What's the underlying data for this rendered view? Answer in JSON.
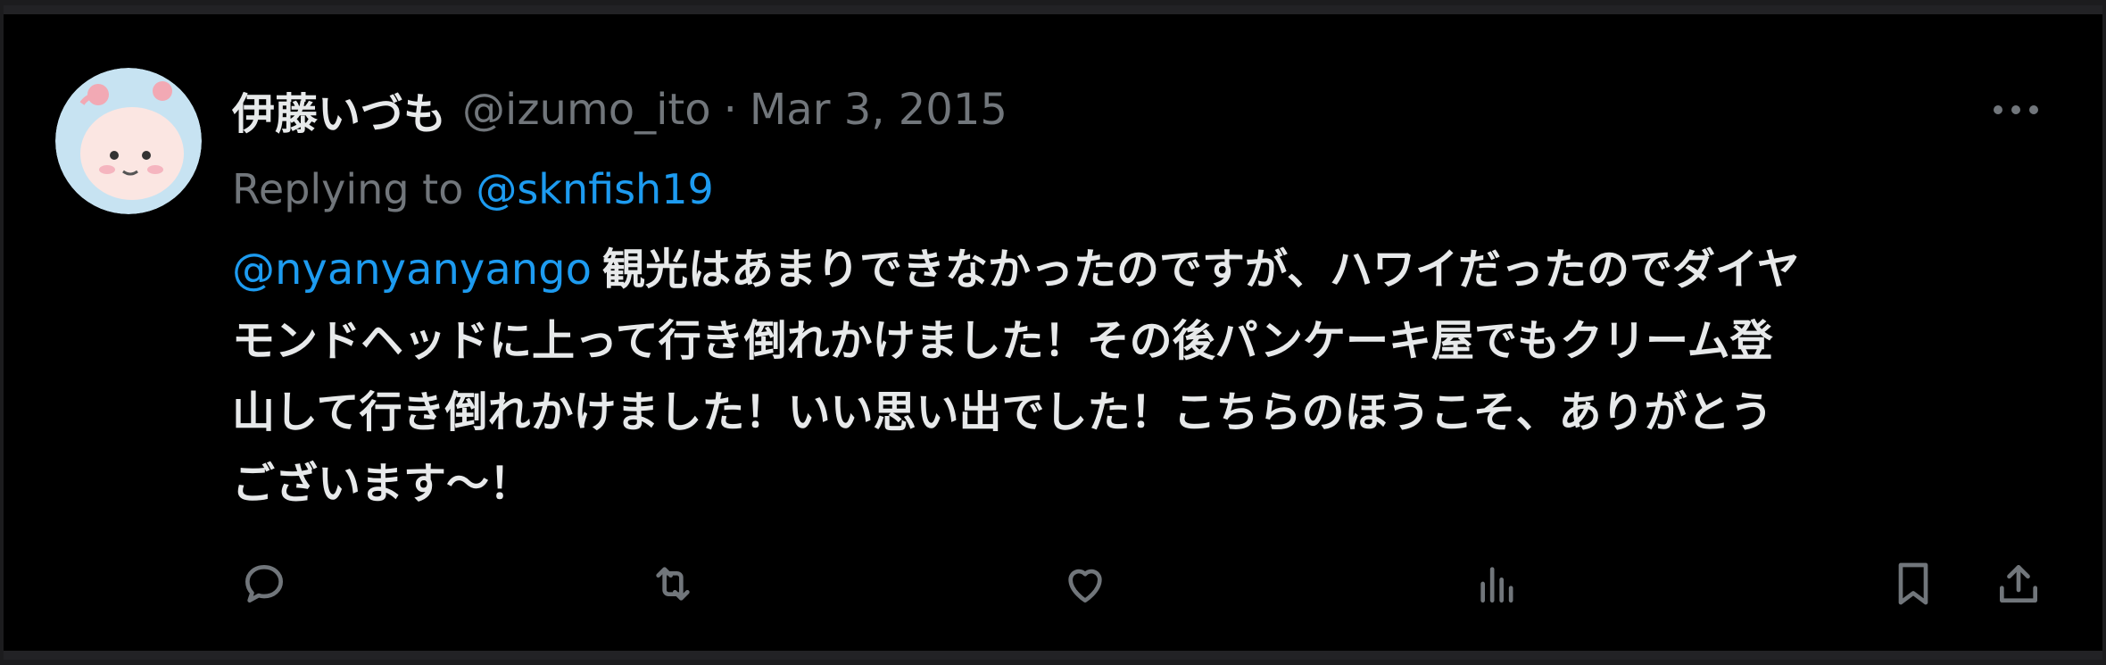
{
  "tweet": {
    "display_name": "伊藤いづも",
    "handle": "@izumo_ito",
    "separator": "·",
    "date": "Mar 3, 2015",
    "reply_prefix": "Replying to",
    "reply_to": "@sknfish19",
    "body_mention": "@nyanyanyango",
    "body_line1": "観光はあまりできなかったのですが、ハワイだったのでダイヤ",
    "body_line2": "モンドヘッドに上って行き倒れかけました！その後パンケーキ屋でもクリーム登",
    "body_line3": "山して行き倒れかけました！いい思い出でした！こちらのほうこそ、ありがとう",
    "body_line4": "ございます〜！"
  },
  "actions": [
    "reply-icon",
    "retweet-icon",
    "like-icon",
    "views-icon",
    "bookmark-icon",
    "share-icon"
  ],
  "colors": {
    "background": "#000000",
    "text_primary": "#e7e9ea",
    "text_secondary": "#71767b",
    "accent": "#1d9bf0"
  }
}
